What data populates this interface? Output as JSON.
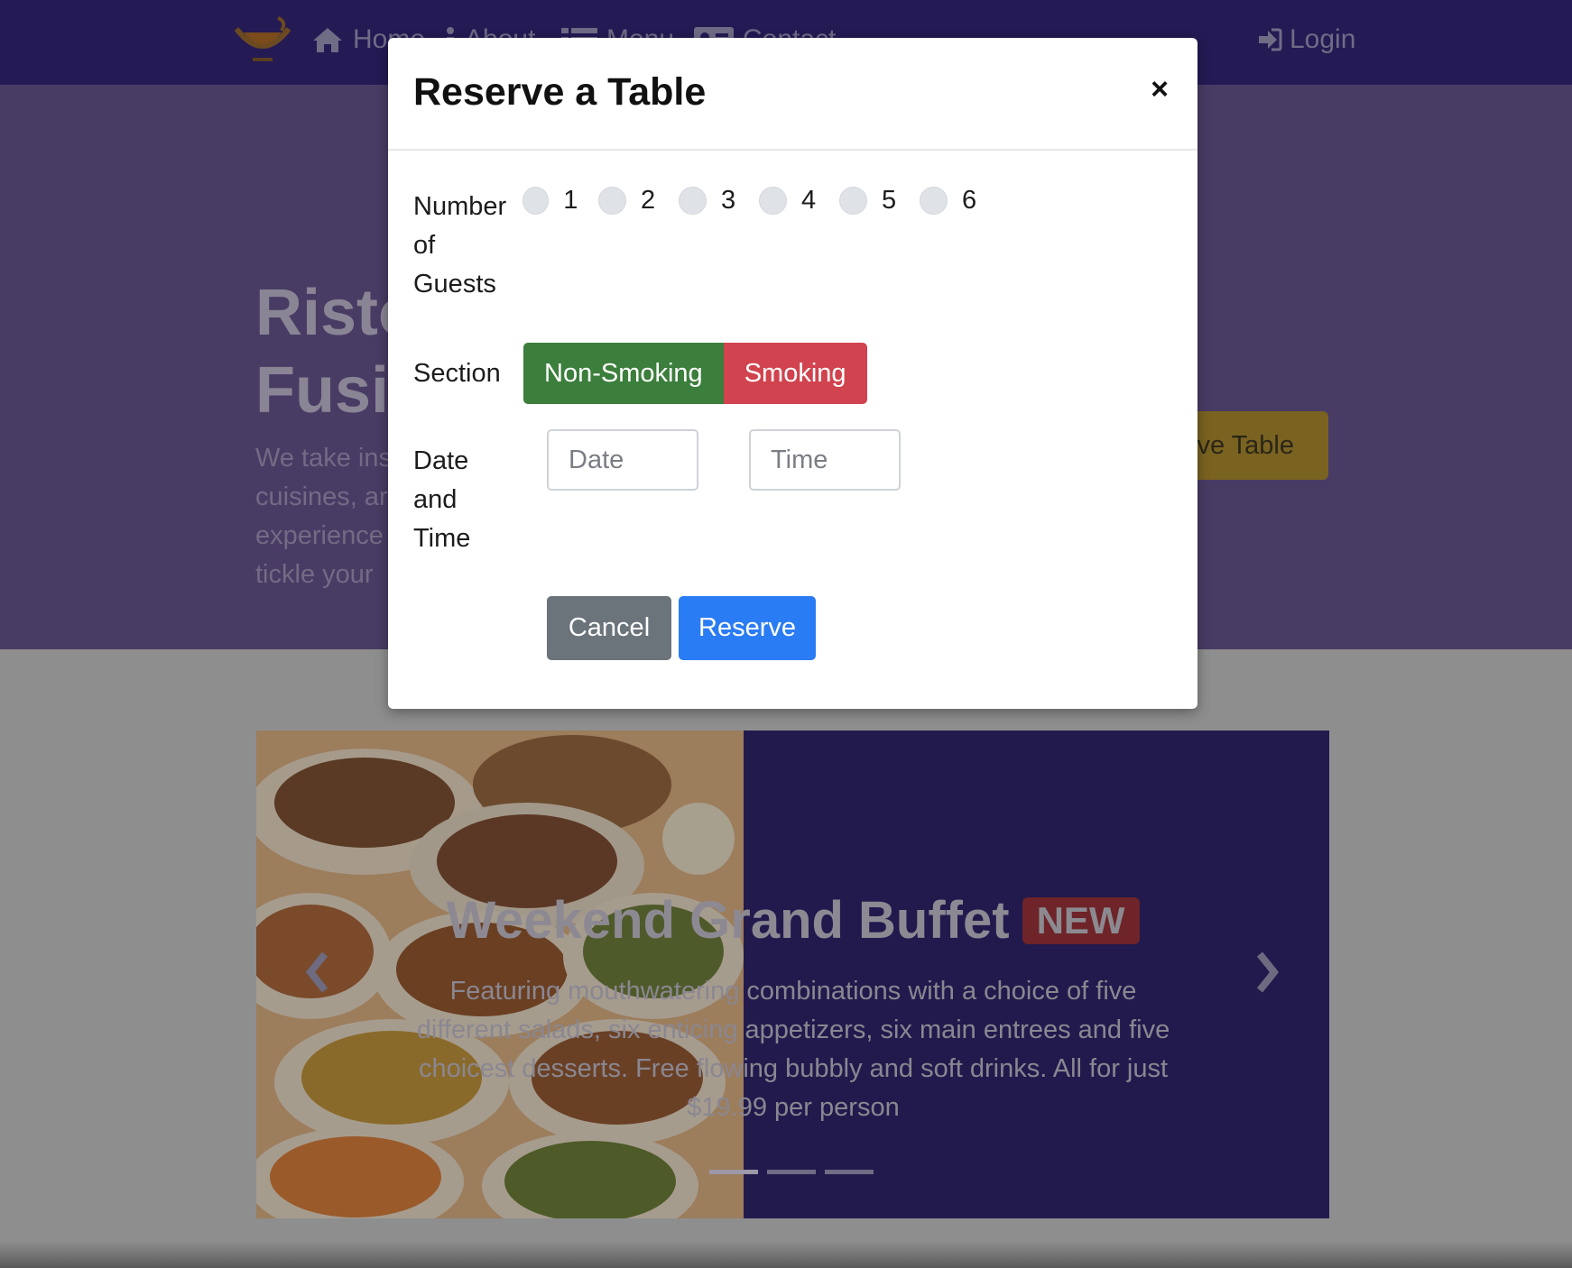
{
  "nav": {
    "home_label": "Home",
    "about_label": "About",
    "menu_label": "Menu",
    "contact_label": "Contact",
    "login_label": "Login"
  },
  "hero": {
    "title_line1": "Risto",
    "title_line2": "Fusic",
    "text_lines": [
      "We take ins",
      "cuisines, ar",
      "experience",
      "tickle your"
    ],
    "reserve_button_label": "ve Table"
  },
  "carousel": {
    "title": "Weekend Grand Buffet",
    "badge": "NEW",
    "text": "Featuring mouthwatering combinations with a choice of five different salads, six enticing appetizers, six main entrees and five choicest desserts. Free flowing bubbly and soft drinks. All for just $19.99 per person",
    "slide_count": 3,
    "active_slide": 1
  },
  "modal": {
    "title": "Reserve a Table",
    "close_symbol": "×",
    "guests_label": "Number of Guests",
    "guest_options": [
      "1",
      "2",
      "3",
      "4",
      "5",
      "6"
    ],
    "section_label": "Section",
    "section_options": [
      "Non-Smoking",
      "Smoking"
    ],
    "datetime_label": "Date and Time",
    "date_placeholder": "Date",
    "time_placeholder": "Time",
    "cancel_label": "Cancel",
    "reserve_label": "Reserve"
  },
  "colors": {
    "navbar": "#241a54",
    "jumbotron_overlay": "#493c64",
    "non_smoking": "#3c7e3c",
    "smoking": "#d1434e",
    "cancel": "#6b737b",
    "reserve": "#2a7cf4"
  }
}
